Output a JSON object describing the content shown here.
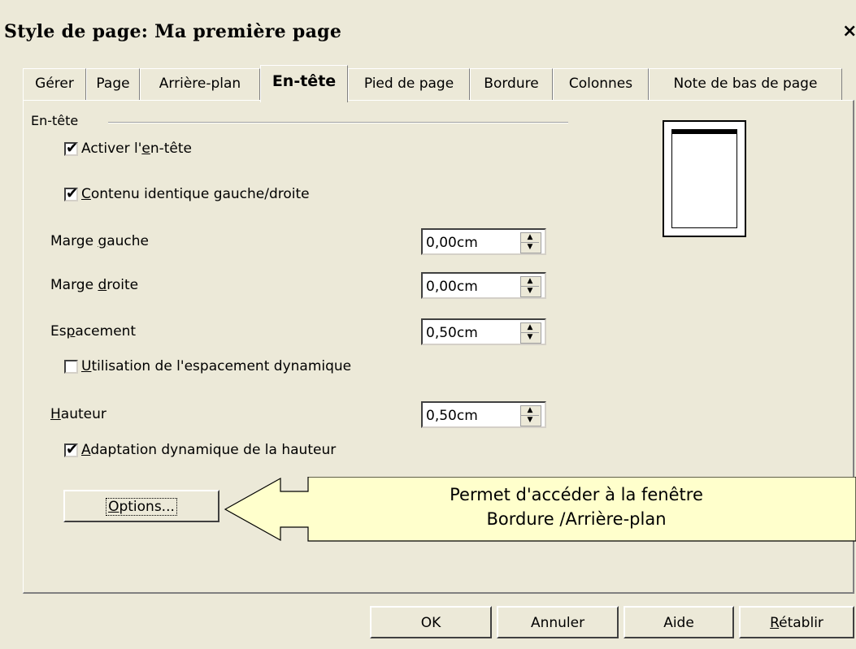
{
  "window": {
    "title": "Style de page: Ma première page",
    "close_glyph": "×"
  },
  "tabs": [
    {
      "label": "Gérer"
    },
    {
      "label": "Page"
    },
    {
      "label": "Arrière-plan"
    },
    {
      "label": "En-tête",
      "active": true
    },
    {
      "label": "Pied de page"
    },
    {
      "label": "Bordure"
    },
    {
      "label": "Colonnes"
    },
    {
      "label": "Note de bas de page"
    }
  ],
  "group": {
    "label": "En-tête",
    "activer": {
      "pre": "Activer l'",
      "acc": "e",
      "post": "n-tête",
      "checked": true
    },
    "contenu": {
      "pre": "",
      "acc": "C",
      "post": "ontenu identique gauche/droite",
      "checked": true
    },
    "marge_gauche": {
      "pre": "Marge ",
      "acc": "g",
      "post": "auche",
      "value": "0,00cm"
    },
    "marge_droite": {
      "pre": "Marge ",
      "acc": "d",
      "post": "roite",
      "value": "0,00cm"
    },
    "espacement": {
      "pre": "Es",
      "acc": "p",
      "post": "acement",
      "value": "0,50cm"
    },
    "dynamique": {
      "pre": "",
      "acc": "U",
      "post": "tilisation de l'espacement dynamique",
      "checked": false
    },
    "hauteur": {
      "pre": "",
      "acc": "H",
      "post": "auteur",
      "value": "0,50cm"
    },
    "adaptation": {
      "pre": "",
      "acc": "A",
      "post": "daptation dynamique de la hauteur",
      "checked": true
    },
    "options": {
      "pre": "",
      "acc": "O",
      "post": "ptions..."
    }
  },
  "callout": {
    "line1": "Permet d'accéder à la fenêtre",
    "line2": "Bordure /Arrière-plan"
  },
  "footer": {
    "ok": "OK",
    "annuler": "Annuler",
    "aide": "Aide",
    "retablir": {
      "pre": "",
      "acc": "R",
      "post": "établir"
    }
  },
  "icons": {
    "check": "check-icon",
    "spin_up": "up-arrow-icon",
    "spin_down": "down-arrow-icon",
    "close": "close-icon"
  },
  "colors": {
    "dialog_bg": "#ece9d8",
    "callout_bg": "#ffffcc"
  }
}
